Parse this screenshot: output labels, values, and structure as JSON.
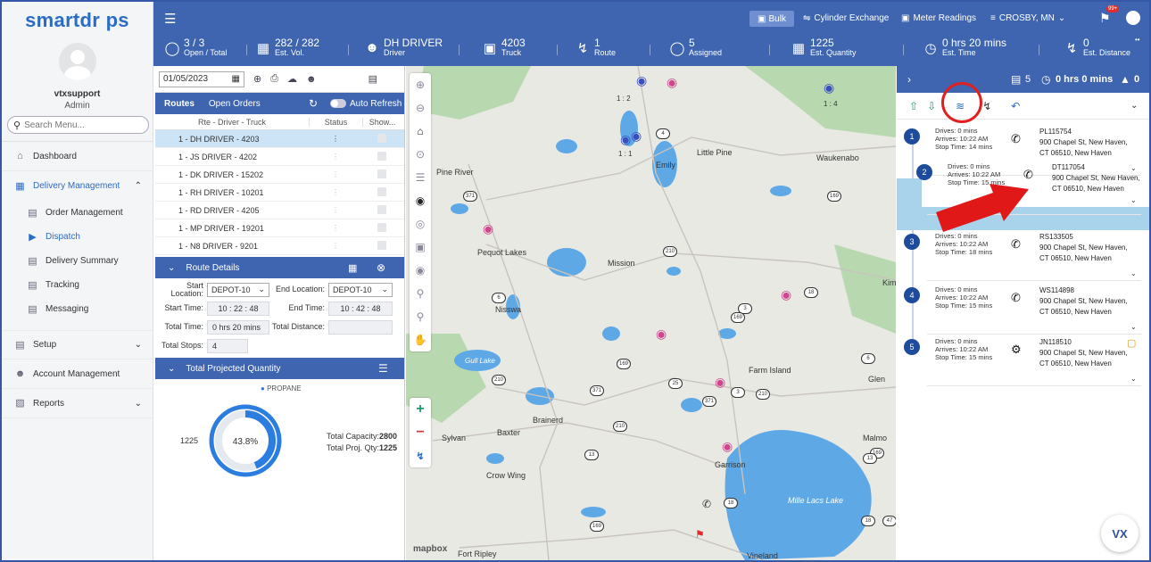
{
  "app": {
    "logo": "smartdr ps",
    "logo_accent": "#2b6cc4"
  },
  "user": {
    "name": "vtxsupport",
    "role": "Admin"
  },
  "search": {
    "placeholder": "Search Menu..."
  },
  "nav": {
    "dashboard": "Dashboard",
    "delivery": "Delivery Management",
    "sub": [
      "Order Management",
      "Dispatch",
      "Delivery Summary",
      "Tracking",
      "Messaging"
    ],
    "setup": "Setup",
    "account": "Account Management",
    "reports": "Reports"
  },
  "topbar": {
    "bulk": "Bulk",
    "cylinder": "Cylinder Exchange",
    "meter": "Meter Readings",
    "location": "CROSBY, MN",
    "badge": "99+",
    "stats": [
      {
        "value": "3 / 3",
        "label": "Open / Total"
      },
      {
        "value": "282 / 282",
        "label": "Est. Vol."
      },
      {
        "value": "DH DRIVER",
        "label": "Driver"
      },
      {
        "value": "4203",
        "label": "Truck"
      },
      {
        "value": "1",
        "label": "Route"
      },
      {
        "value": "5",
        "label": "Assigned"
      },
      {
        "value": "1225",
        "label": "Est. Quantity"
      },
      {
        "value": "0 hrs 20 mins",
        "label": "Est. Time"
      },
      {
        "value": "0",
        "label": "Est. Distance"
      }
    ]
  },
  "routes": {
    "date": "01/05/2023",
    "tab_routes": "Routes",
    "tab_orders": "Open Orders",
    "auto_refresh": "Auto Refresh",
    "col_rte": "Rte - Driver - Truck",
    "col_status": "Status",
    "col_show": "Show...",
    "rows": [
      "1 - DH DRIVER - 4203",
      "1 - JS DRIVER - 4202",
      "1 - DK DRIVER - 15202",
      "1 - RH DRIVER - 10201",
      "1 - RD DRIVER - 4205",
      "1 - MP DRIVER - 19201",
      "1 - N8 DRIVER - 9201"
    ]
  },
  "route_details": {
    "title": "Route Details",
    "start_location_label": "Start Location:",
    "start_location": "DEPOT-10",
    "end_location_label": "End Location:",
    "end_location": "DEPOT-10",
    "start_time_label": "Start Time:",
    "start_time": "10 : 22 : 48",
    "end_time_label": "End Time:",
    "end_time": "10 : 42 : 48",
    "total_time_label": "Total Time:",
    "total_time": "0 hrs 20 mins",
    "total_distance_label": "Total Distance:",
    "total_distance": "",
    "total_stops_label": "Total Stops:",
    "total_stops": "4"
  },
  "projected": {
    "title": "Total Projected Quantity",
    "legend": "PROPANE",
    "percent": "43.8%",
    "fill_fraction": 0.438,
    "qty": "1225",
    "capacity_label": "Total Capacity:",
    "capacity": "2800",
    "proj_label": "Total Proj. Qty:",
    "proj": "1225"
  },
  "map": {
    "labels": [
      "Pine River",
      "Emily",
      "Little Pine",
      "Waukenabo",
      "Pequot Lakes",
      "Mission",
      "Nisswa",
      "Gull Lake",
      "Farm Island",
      "Brainerd",
      "Baxter",
      "Sylvan",
      "Crow Wing",
      "Garrison",
      "Mille Lacs Lake",
      "Malmo",
      "Glen",
      "Kim",
      "Fort Ripley",
      "Vineland"
    ],
    "pin_labels": [
      "1 : 2",
      "1 : 4",
      "1 : 1"
    ],
    "attribution": "mapbox",
    "roads": [
      "4",
      "371",
      "210",
      "169",
      "6",
      "18",
      "3",
      "25",
      "169",
      "371",
      "210",
      "169",
      "210",
      "371",
      "210",
      "6",
      "169",
      "13",
      "18",
      "47",
      "18",
      "169",
      "3",
      "13"
    ]
  },
  "stops_panel": {
    "count": "5",
    "time": "0 hrs 0 mins",
    "distance": "0",
    "stops": [
      {
        "num": "1",
        "drives": "Drives: 0 mins",
        "arrives": "Arrives: 10:22 AM",
        "stop": "Stop Time: 14 mins",
        "id": "PL115754",
        "addr1": "900 Chapel St, New Haven,",
        "addr2": "CT 06510, New Haven"
      },
      {
        "num": "2",
        "drives": "Drives: 0 mins",
        "arrives": "Arrives: 10:22 AM",
        "stop": "Stop Time: 15 mins",
        "id": "DT117054",
        "addr1": "900 Chapel St, New Haven,",
        "addr2": "CT 06510, New Haven"
      },
      {
        "num": "3",
        "drives": "Drives: 0 mins",
        "arrives": "Arrives: 10:22 AM",
        "stop": "Stop Time: 18 mins",
        "id": "RS133505",
        "addr1": "900 Chapel St, New Haven,",
        "addr2": "CT 06510, New Haven"
      },
      {
        "num": "4",
        "drives": "Drives: 0 mins",
        "arrives": "Arrives: 10:22 AM",
        "stop": "Stop Time: 15 mins",
        "id": "WS114898",
        "addr1": "900 Chapel St, New Haven,",
        "addr2": "CT 06510, New Haven"
      },
      {
        "num": "5",
        "drives": "Drives: 0 mins",
        "arrives": "Arrives: 10:22 AM",
        "stop": "Stop Time: 15 mins",
        "id": "JN118510",
        "addr1": "900 Chapel St, New Haven,",
        "addr2": "CT 06510, New Haven"
      }
    ]
  },
  "chat": {
    "label": "VX"
  }
}
